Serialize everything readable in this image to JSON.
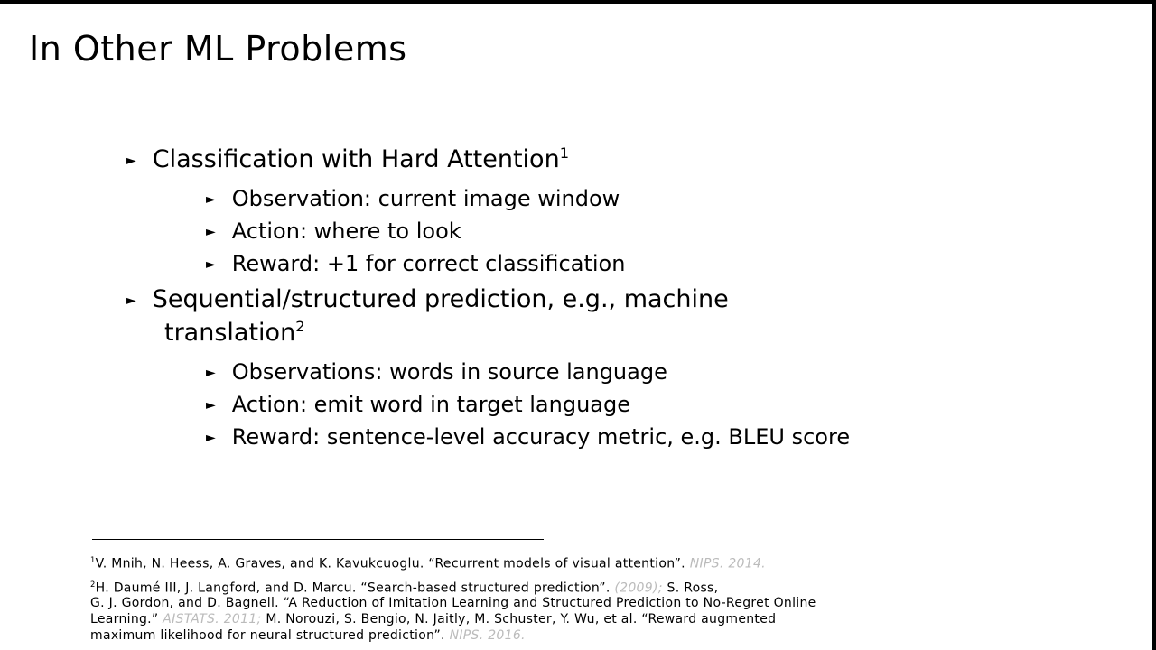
{
  "title": "In Other ML Problems",
  "bullets": {
    "b1": {
      "label": "Classification with Hard Attention",
      "sup": "1"
    },
    "b1a": "Observation: current image window",
    "b1b": "Action: where to look",
    "b1c": "Reward: +1 for correct classification",
    "b2": {
      "label": "Sequential/structured prediction, e.g., machine",
      "cont": "translation",
      "sup": "2"
    },
    "b2a": "Observations: words in source language",
    "b2b": "Action: emit word in target language",
    "b2c": "Reward: sentence-level accuracy metric, e.g. BLEU score"
  },
  "footnotes": {
    "fn1_num": "1",
    "fn1_text": "V. Mnih, N. Heess, A. Graves, and K. Kavukcuoglu. “Recurrent models of visual attention”.",
    "fn1_venue": "NIPS. 2014.",
    "fn2_num": "2",
    "fn2_text": "H. Daumé III, J. Langford, and D. Marcu. “Search-based structured prediction”.",
    "fn2_venue": "(2009);",
    "fn2_text2": "S. Ross,",
    "fn2_line2": "G. J. Gordon, and D. Bagnell. “A Reduction of Imitation Learning and Structured Prediction to No-Regret Online",
    "fn2_line3a": "Learning.”",
    "fn2_line3_venue": "AISTATS. 2011;",
    "fn2_line3b": "M. Norouzi, S. Bengio, N. Jaitly, M. Schuster, Y. Wu, et al. “Reward augmented",
    "fn2_line4a": "maximum likelihood for neural structured prediction”.",
    "fn2_line4_venue": "NIPS. 2016."
  }
}
